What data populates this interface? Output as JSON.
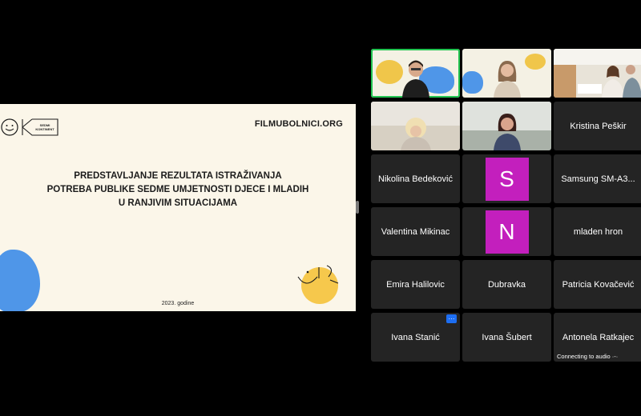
{
  "slide": {
    "site": "FILMUBOLNICI.ORG",
    "logo_text": "SEDMI KONTINENT",
    "title_lines": [
      "PREDSTAVLJANJE REZULTATA ISTRAŽIVANJA",
      "POTREBA PUBLIKE SEDME UMJETNOSTI DJECE I MLADIH",
      "U RANJIVIM SITUACIJAMA"
    ],
    "year": "2023. godine"
  },
  "participants": [
    {
      "name": "Kristina Peškir"
    },
    {
      "name": "Nikolina Bedeković"
    },
    {
      "name": "Samsung SM-A3..."
    },
    {
      "name": "Valentina Mikinac"
    },
    {
      "name": "mladen hron"
    },
    {
      "name": "Emira Halilovic"
    },
    {
      "name": "Dubravka"
    },
    {
      "name": "Patricia Kovačević"
    },
    {
      "name": "Ivana Stanić"
    },
    {
      "name": "Ivana Šubert"
    },
    {
      "name": "Antonela Ratkajec"
    }
  ],
  "avatars": [
    "S",
    "N"
  ],
  "more_label": "···",
  "status_text": "Connecting to audio ·-·",
  "colors": {
    "background": "#000000",
    "tile": "#242424",
    "avatar": "#c31fbd",
    "active_speaker": "#23c552",
    "slide_background": "#fbf6e9"
  },
  "icons": {
    "more": "more-options-icon",
    "logo": "sedmi-kontinent-logo"
  }
}
